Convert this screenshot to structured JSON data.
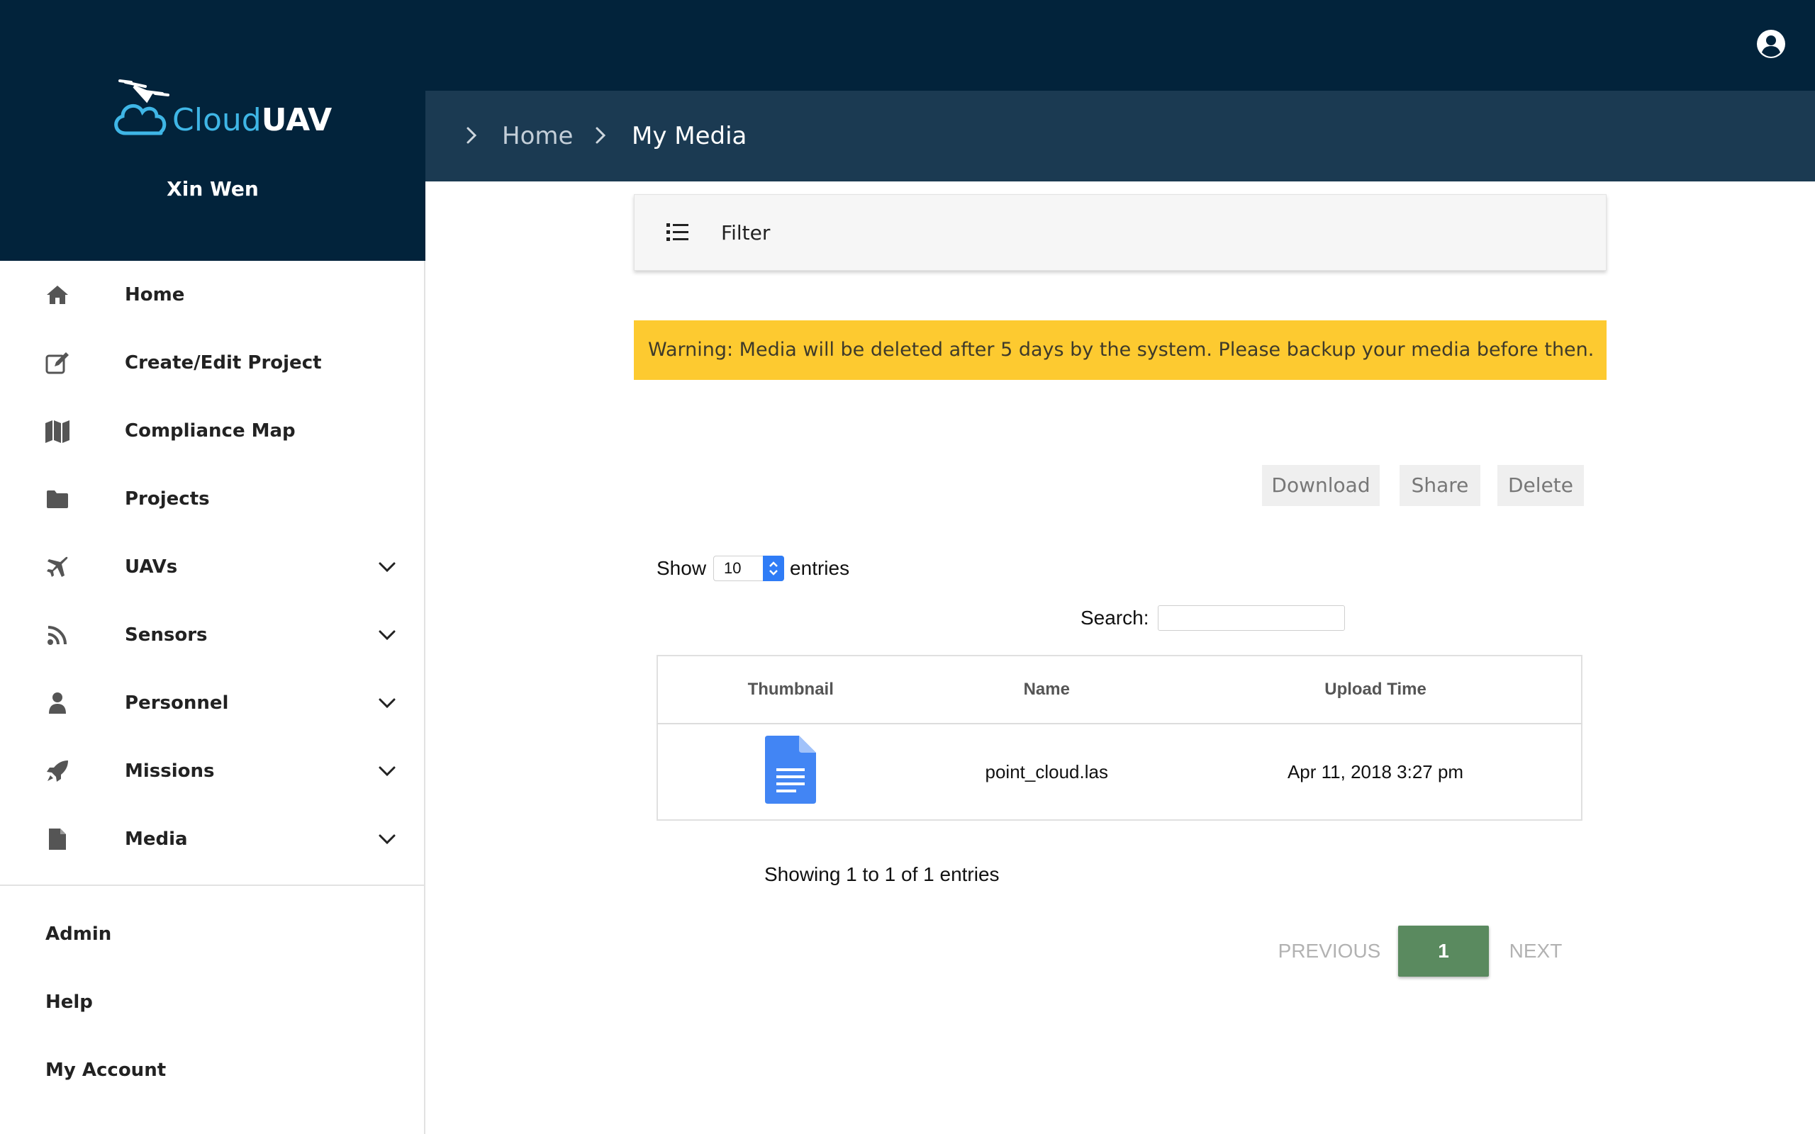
{
  "brand": {
    "name_part1": "Cloud",
    "name_part2": "UAV",
    "accent_color": "#3fb6e6",
    "header_color": "#02233b"
  },
  "user": {
    "name": "Xin Wen"
  },
  "sidebar": {
    "items": [
      {
        "label": "Home",
        "icon": "home-icon",
        "expandable": false
      },
      {
        "label": "Create/Edit Project",
        "icon": "edit-icon",
        "expandable": false
      },
      {
        "label": "Compliance Map",
        "icon": "map-icon",
        "expandable": false
      },
      {
        "label": "Projects",
        "icon": "folder-icon",
        "expandable": false
      },
      {
        "label": "UAVs",
        "icon": "plane-icon",
        "expandable": true
      },
      {
        "label": "Sensors",
        "icon": "rss-icon",
        "expandable": true
      },
      {
        "label": "Personnel",
        "icon": "person-icon",
        "expandable": true
      },
      {
        "label": "Missions",
        "icon": "rocket-icon",
        "expandable": true
      },
      {
        "label": "Media",
        "icon": "file-icon",
        "expandable": true
      }
    ],
    "bottom_links": [
      {
        "label": "Admin"
      },
      {
        "label": "Help"
      },
      {
        "label": "My Account"
      }
    ]
  },
  "topbar": {
    "account_icon": "user-circle-icon"
  },
  "breadcrumb": {
    "items": [
      "Home",
      "My Media"
    ]
  },
  "filter": {
    "label": "Filter",
    "icon": "list-icon"
  },
  "warning": {
    "text": "Warning: Media will be deleted after 5 days by the system. Please backup your media before then.",
    "color": "#fdca30"
  },
  "actions": {
    "download": "Download",
    "share": "Share",
    "delete": "Delete"
  },
  "table_controls": {
    "show_label": "Show",
    "entries_value": "10",
    "entries_label": "entries",
    "search_label": "Search:",
    "search_value": ""
  },
  "table": {
    "columns": [
      "Thumbnail",
      "Name",
      "Upload Time"
    ],
    "rows": [
      {
        "thumbnail_icon": "document-icon",
        "name": "point_cloud.las",
        "upload_time": "Apr 11, 2018 3:27 pm"
      }
    ]
  },
  "info": "Showing 1 to 1 of 1 entries",
  "pagination": {
    "previous": "Previous",
    "current": "1",
    "next": "Next",
    "active_color": "#5a8a5f"
  }
}
